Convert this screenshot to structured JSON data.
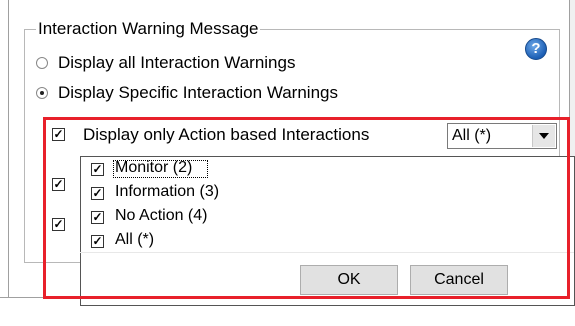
{
  "group": {
    "title": "Interaction Warning Message"
  },
  "radios": [
    {
      "label": "Display all Interaction Warnings",
      "selected": false
    },
    {
      "label": "Display Specific Interaction Warnings",
      "selected": true
    }
  ],
  "help_icon": {
    "glyph": "?",
    "icon": "help-icon"
  },
  "action_filter": {
    "label": "Display only Action based Interactions",
    "checked": true,
    "combo_value": "All (*)"
  },
  "hidden_checkboxes": [
    {
      "checked": true
    },
    {
      "checked": true
    }
  ],
  "dropdown": {
    "items": [
      {
        "label": "Monitor (2)",
        "checked": true
      },
      {
        "label": "Information (3)",
        "checked": true
      },
      {
        "label": "No Action (4)",
        "checked": true
      },
      {
        "label": "All (*)",
        "checked": true
      }
    ],
    "ok_label": "OK",
    "cancel_label": "Cancel"
  },
  "colors": {
    "highlight": "#e8202a",
    "help_icon": "#1c5fb5"
  }
}
